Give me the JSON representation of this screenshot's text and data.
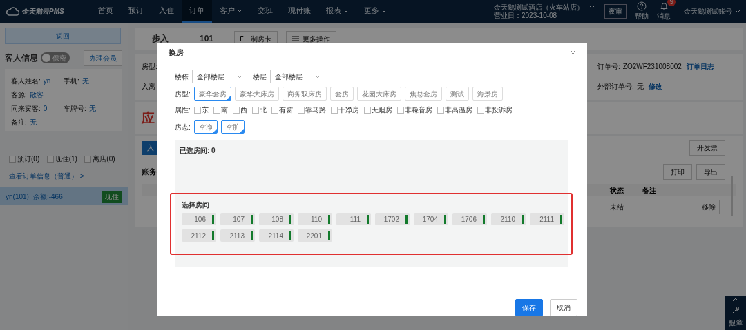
{
  "navbar": {
    "logo": "金天鹅云PMS",
    "menu": [
      {
        "label": "首页",
        "selected": false,
        "dropdown": false
      },
      {
        "label": "预订",
        "selected": false,
        "dropdown": false
      },
      {
        "label": "入住",
        "selected": false,
        "dropdown": false
      },
      {
        "label": "订单",
        "selected": true,
        "dropdown": false
      },
      {
        "label": "客户",
        "selected": false,
        "dropdown": true
      },
      {
        "label": "交班",
        "selected": false,
        "dropdown": false
      },
      {
        "label": "现付账",
        "selected": false,
        "dropdown": false
      },
      {
        "label": "报表",
        "selected": false,
        "dropdown": true
      },
      {
        "label": "更多",
        "selected": false,
        "dropdown": true
      }
    ],
    "hotel": {
      "name": "金天鹅测试酒店（火车站店）",
      "business_day": "营业日：2023-10-08"
    },
    "night_audit": "夜审",
    "help": "帮助",
    "messages": {
      "label": "消息",
      "badge": "9"
    },
    "account": "金天鹅测试账号"
  },
  "sidebar": {
    "back": "返回",
    "guest_title": "客人信息",
    "privacy_toggle": {
      "label": "保密",
      "on": false
    },
    "member_button": "办理会员",
    "field_rows": [
      [
        {
          "label": "客人姓名:",
          "value": "yn"
        },
        {
          "label": "手机:",
          "value": "无"
        }
      ],
      [
        {
          "label": "客源:",
          "value": "散客"
        }
      ],
      [
        {
          "label": "同来宾客:",
          "value": "0"
        },
        {
          "label": "车牌号:",
          "value": "无"
        }
      ],
      [
        {
          "label": "备注:",
          "value": "无"
        }
      ]
    ],
    "filters": [
      {
        "label": "预订(0)",
        "checked": false
      },
      {
        "label": "现住(1)",
        "checked": false
      },
      {
        "label": "离店(0)",
        "checked": false
      }
    ],
    "order_link": "查看订单信息（普通） >",
    "guests": [
      {
        "name": "yn(101)",
        "balance": "余额:-466",
        "status": "现住",
        "selected": true
      }
    ]
  },
  "order": {
    "type": "步入",
    "room": "101",
    "actions": [
      "制房卡",
      "更多操作"
    ],
    "room_type_label": "房型:",
    "stay_label": "入离",
    "order_no": {
      "label": "订单号:",
      "value": "ZO2WF231008002",
      "link": "订单日志"
    },
    "external_no": {
      "label": "外部订单号:",
      "value": "无",
      "link": "修改"
    },
    "amount_heading": "应",
    "post_button": "入",
    "invoice_button": "开发票",
    "bills_title": "账务",
    "print_button": "打印",
    "export_button": "导出",
    "columns": [
      "状态",
      "备注"
    ],
    "rows": [
      {
        "status": "未结",
        "action": "移除"
      }
    ]
  },
  "float_tool": {
    "label": "报障"
  },
  "modal": {
    "title": "换房",
    "building": {
      "label": "楼栋",
      "value": "全部楼层"
    },
    "floor": {
      "label": "楼层",
      "value": "全部楼层"
    },
    "room_types": {
      "label": "房型:",
      "options": [
        {
          "label": "豪华套房",
          "selected": true
        },
        {
          "label": "豪华大床房",
          "selected": false
        },
        {
          "label": "商务双床房",
          "selected": false
        },
        {
          "label": "套房",
          "selected": false
        },
        {
          "label": "花园大床房",
          "selected": false
        },
        {
          "label": "焦总套房",
          "selected": false
        },
        {
          "label": "测试",
          "selected": false
        },
        {
          "label": "海景房",
          "selected": false
        }
      ]
    },
    "attributes": {
      "label": "属性:",
      "options": [
        {
          "label": "东",
          "checked": false
        },
        {
          "label": "南",
          "checked": false
        },
        {
          "label": "西",
          "checked": false
        },
        {
          "label": "北",
          "checked": false
        },
        {
          "label": "有窗",
          "checked": false
        },
        {
          "label": "靠马路",
          "checked": false
        },
        {
          "label": "干净房",
          "checked": false
        },
        {
          "label": "无烟房",
          "checked": false
        },
        {
          "label": "非噪音房",
          "checked": false
        },
        {
          "label": "非高温房",
          "checked": false
        },
        {
          "label": "非投诉房",
          "checked": false
        }
      ]
    },
    "room_states": {
      "label": "房态:",
      "options": [
        {
          "label": "空净",
          "selected": true
        },
        {
          "label": "空脏",
          "selected": true
        }
      ]
    },
    "selected_rooms": "已选房间: 0",
    "room_picker": {
      "title": "选择房间",
      "rooms": [
        "106",
        "107",
        "108",
        "110",
        "111",
        "1702",
        "1704",
        "1706",
        "2110",
        "2111",
        "2112",
        "2113",
        "2114",
        "2201"
      ]
    },
    "buttons": [
      {
        "label": "保存",
        "kind": "primary"
      },
      {
        "label": "取消",
        "kind": "default"
      }
    ]
  }
}
